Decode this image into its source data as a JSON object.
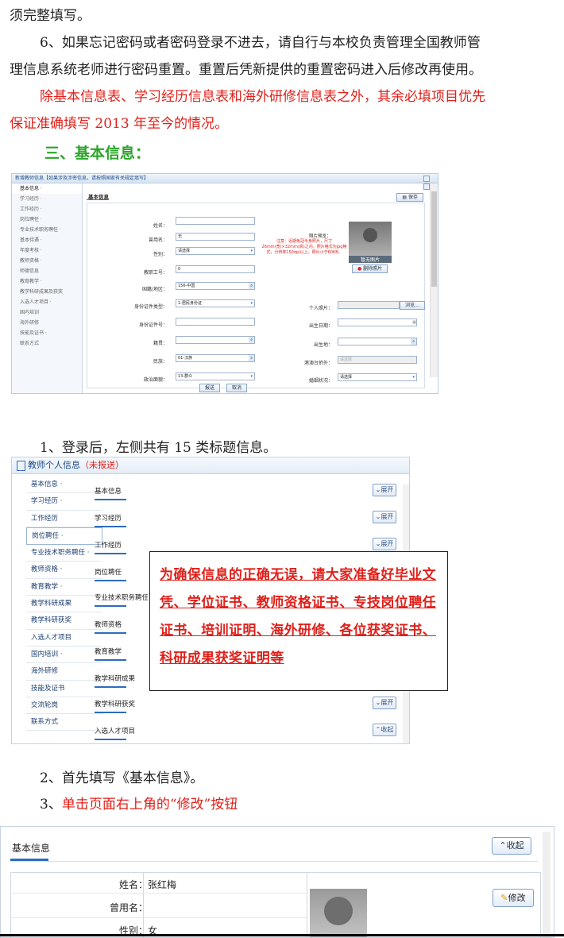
{
  "text": {
    "line0": "须完整填写。",
    "p6a": "6、如果忘记密码或者密码登录不进去，请自行与本校负责管理全国教师管",
    "p6b": "理信息系统老师进行密码重置。重置后凭新提供的重置密码进入后修改再使用。",
    "redA": "除基本信息表、学习经历信息表和海外研修信息表之外，其余必填项目优先",
    "redB": "保证准确填写 2013 年至今的情况。",
    "heading3": "三、基本信息：",
    "step1": "1、登录后，左侧共有 15 类标题信息。",
    "step2": "2、首先填写《基本信息》。",
    "step3_prefix": "3、",
    "step3_red": "单击页面右上角的“修改”按钮"
  },
  "shot1": {
    "title": "新增教师信息【如果涉及涉密信息，请按照国家有关规定填写】",
    "sidebar": [
      "基本信息 ·",
      "学习经历 ·",
      "工作经历 ·",
      "岗位聘任 ·",
      "专业技术职务聘任 ·",
      "基本待遇 ·",
      "年度考核 ·",
      "教师资格 ·",
      "师德信息",
      "教育教学 ·",
      "教学科研成果及获奖",
      "入选人才项目 ·",
      "国内培训",
      "海外研修",
      "技能及证书 ·",
      "联系方式"
    ],
    "section": "基本信息",
    "save": "保存",
    "labels": {
      "name": "姓名：",
      "used_name": "曾用名：",
      "gender": "性别：",
      "emp_no": "教职工号：",
      "nation": "国籍/地区：",
      "idtype": "身份证件类型：",
      "idno": "身份证件号：",
      "native": "籍贯：",
      "ethnic": "民族：",
      "political": "政治面貌：",
      "photo": "个人照片：",
      "birth": "出生日期：",
      "birthplace": "出生地：",
      "hk": "港澳台侨外：",
      "marital": "婚姻状况："
    },
    "values": {
      "used_name": "无",
      "gender": "请选择",
      "emp_no": "0",
      "nation": "156-中国",
      "idtype": "1-居民身份证",
      "ethnic": "01-汉族",
      "political": "13-群众",
      "marital": "请选择",
      "hk": "请选择"
    },
    "photo_preview": "照片预览：",
    "photo_note": "注意：近期免冠半身照片，尺寸26mm(宽)×32mm(高)之内，照片格式为jpg格式，分辨率150dpi以上，照片小于60KB。",
    "no_photo": "暂无图片",
    "delete_photo": "删除照片",
    "browse": "浏览...",
    "submit": "报送",
    "cancel": "取消"
  },
  "shot2": {
    "title": "教师个人信息",
    "status": "（未报送）",
    "sidebar": [
      "基本信息 ·",
      "学习经历 ·",
      "工作经历",
      "岗位聘任 ·",
      "专业技术职务聘任 ·",
      "教师资格 ·",
      "教育教学 ·",
      "教学科研成果",
      "教学科研获奖",
      "入选人才项目",
      "国内培训 ·",
      "海外研修",
      "技能及证书",
      "交流轮岗",
      "联系方式"
    ],
    "sections": [
      "基本信息",
      "学习经历",
      "工作经历",
      "岗位聘任",
      "专业技术职务聘任",
      "教师资格",
      "教育教学",
      "教学科研成果",
      "教学科研获奖",
      "入选人才项目"
    ],
    "expand": "展开",
    "collapse": "收起",
    "notice": "为确保信息的正确无误，请大家准备好毕业文凭、学位证书、教师资格证书、专技岗位聘任证书、培训证明、海外研修、各位获奖证书、科研成果获奖证明等"
  },
  "shot3": {
    "header": "基本信息",
    "collapse": "收起",
    "edit": "修改",
    "name_label": "姓名：",
    "name_value": "张红梅",
    "used_name_label": "曾用名：",
    "gender_label": "性别：",
    "gender_value": "女"
  }
}
